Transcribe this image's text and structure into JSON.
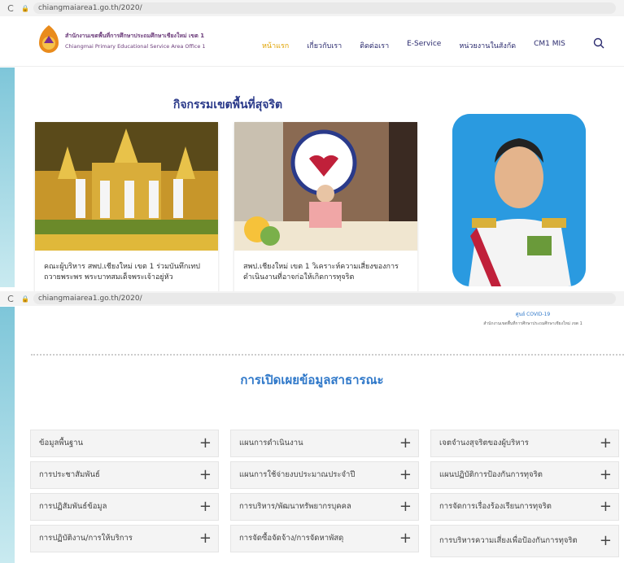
{
  "browser_top": {
    "url": "chiangmaiarea1.go.th/2020/"
  },
  "header": {
    "org_th": "สำนักงานเขตพื้นที่การศึกษาประถมศึกษาเชียงใหม่ เขต 1",
    "org_en": "Chiangmai Primary Educational Service Area Office 1",
    "nav": [
      "หน้าแรก",
      "เกี่ยวกับเรา",
      "ติดต่อเรา",
      "E-Service",
      "หน่วยงานในสังกัด",
      "CM1 MIS"
    ]
  },
  "section1": {
    "title": "กิจกรรมเขตพื้นที่สุจริต",
    "cards": [
      {
        "caption": "คณะผู้บริหาร สพป.เชียงใหม่ เขต 1 ร่วมบันทึกเทปถวายพระพร พระบาทสมเด็จพระเจ้าอยู่หัว"
      },
      {
        "caption": "สพป.เชียงใหม่ เขต 1 วิเคราะห์ความเสี่ยงของการดำเนินงานที่อาจก่อให้เกิดการทุจริต"
      }
    ]
  },
  "browser_second": {
    "url": "chiangmaiarea1.go.th/2020/"
  },
  "covid_note": {
    "title": "ศูนย์ COVID-19",
    "sub": "สำนักงานเขตพื้นที่การศึกษาประถมศึกษาเชียงใหม่ เขต 1"
  },
  "section2": {
    "title": "การเปิดเผยข้อมูลสาธารณะ",
    "items": [
      "ข้อมูลพื้นฐาน",
      "แผนการดำเนินงาน",
      "เจตจำนงสุจริตของผู้บริหาร",
      "การประชาสัมพันธ์",
      "แผนการใช้จ่ายงบประมาณประจำปี",
      "แผนปฏิบัติการป้องกันการทุจริต",
      "การปฏิสัมพันธ์ข้อมูล",
      "การบริหาร/พัฒนาทรัพยากรบุคคล",
      "การจัดการเรื่องร้องเรียนการทุจริต",
      "การปฏิบัติงาน/การให้บริการ",
      "การจัดซื้อจัดจ้าง/การจัดหาพัสดุ",
      "การบริหารความเสี่ยงเพื่อป้องกันการทุจริต"
    ]
  },
  "colors": {
    "nav_active": "#e0a300",
    "title_blue": "#2b3a8a",
    "section_blue": "#2f78c9"
  }
}
